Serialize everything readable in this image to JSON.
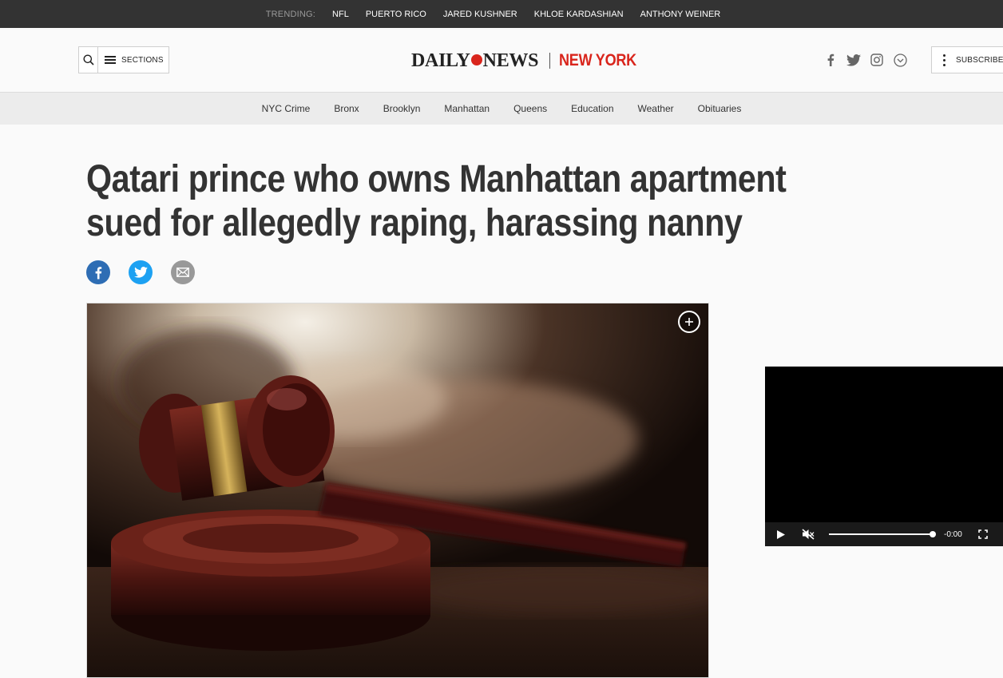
{
  "trending": {
    "label": "TRENDING:",
    "links": [
      "NFL",
      "PUERTO RICO",
      "JARED KUSHNER",
      "KHLOE KARDASHIAN",
      "ANTHONY WEINER"
    ]
  },
  "header": {
    "sections_label": "SECTIONS",
    "logo_left": "DAILY",
    "logo_right": "NEWS",
    "edition": "NEW YORK",
    "subscribe_label": "SUBSCRIBE"
  },
  "nav": {
    "items": [
      "NYC Crime",
      "Bronx",
      "Brooklyn",
      "Manhattan",
      "Queens",
      "Education",
      "Weather",
      "Obituaries"
    ]
  },
  "article": {
    "headline": "Qatari prince who owns Manhattan apartment sued for allegedly raping, harassing nanny"
  },
  "video": {
    "time": "-0:00",
    "progress": 1.0
  },
  "colors": {
    "brand_red": "#d9251c",
    "facebook": "#3b5998",
    "twitter": "#1da1f2",
    "email": "#999999"
  },
  "icons": {
    "share": [
      "facebook-icon",
      "twitter-icon",
      "email-icon"
    ],
    "social_top": [
      "facebook-icon",
      "twitter-icon",
      "instagram-icon",
      "chevron-down-circle-icon"
    ]
  }
}
